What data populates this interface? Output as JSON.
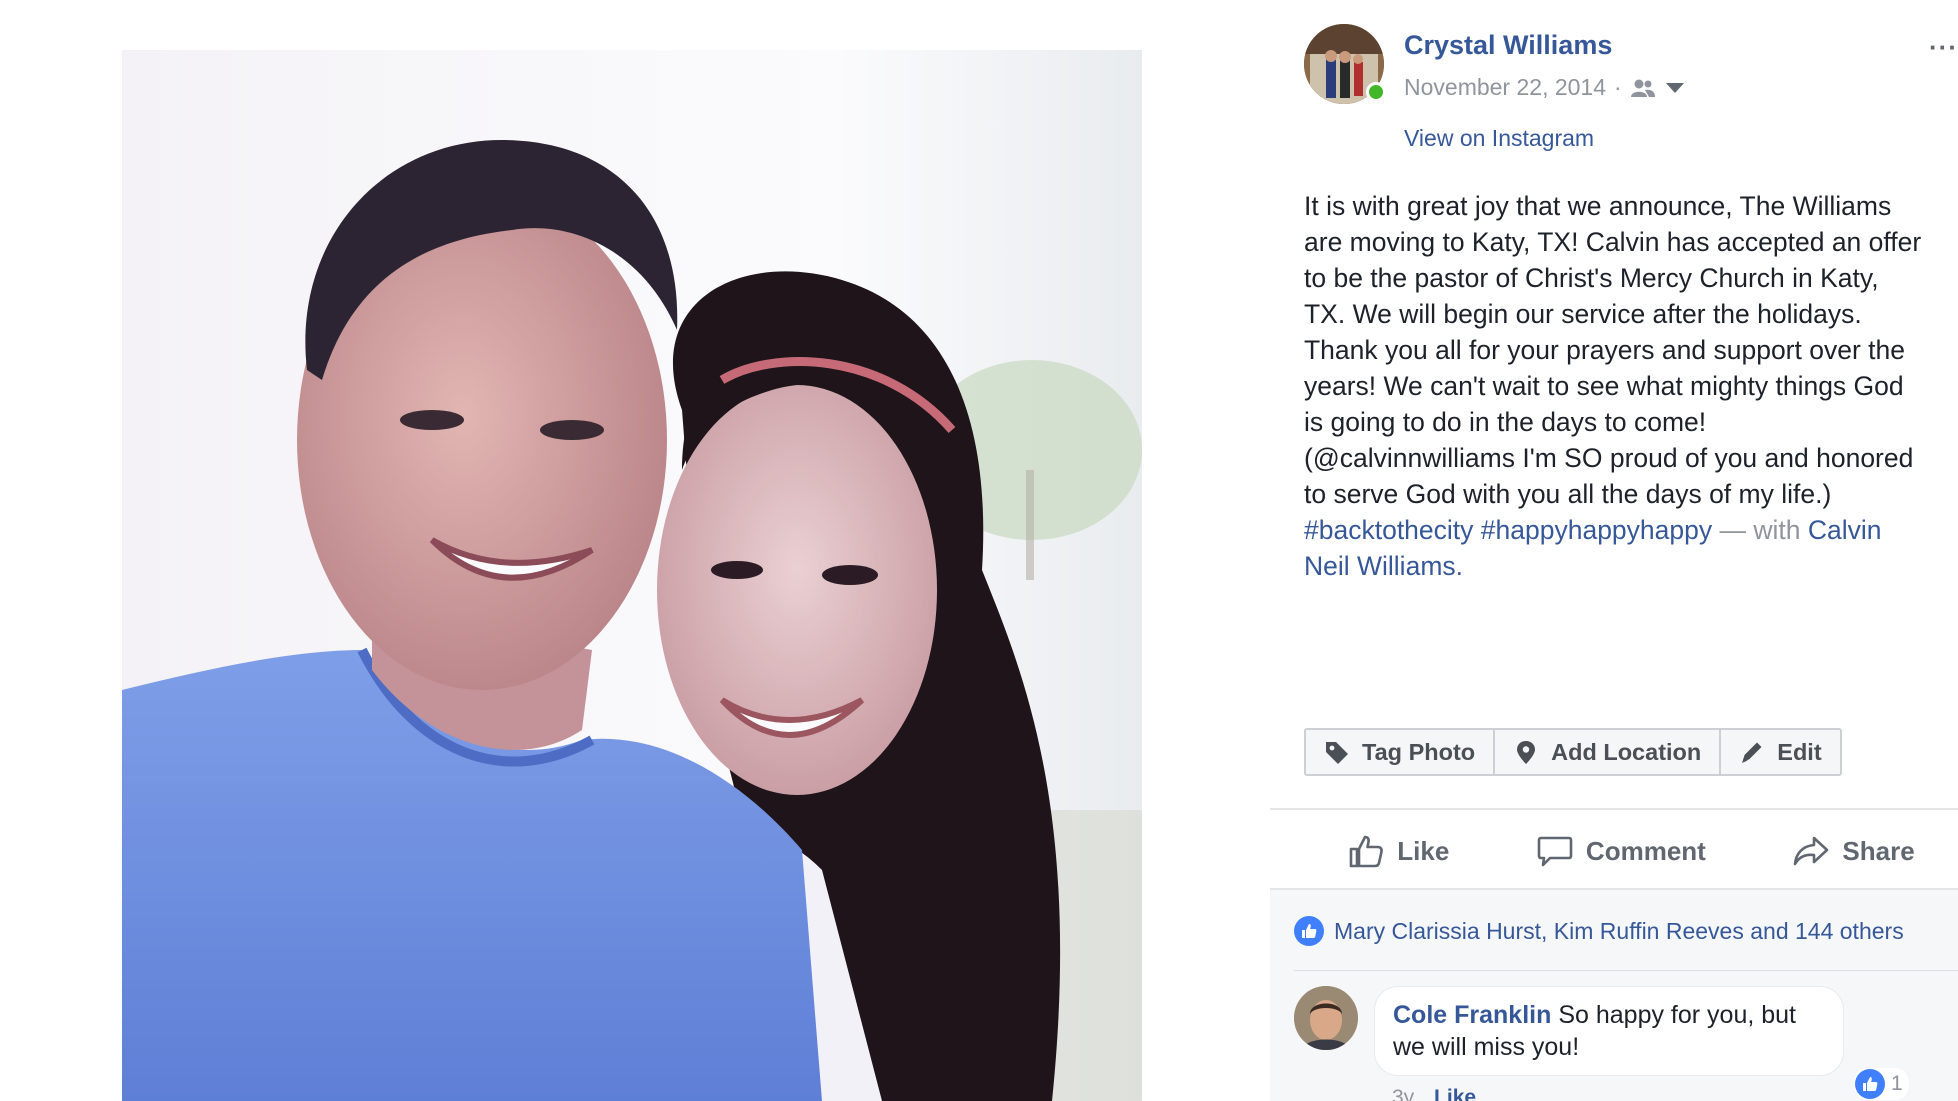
{
  "post": {
    "author": "Crystal Williams",
    "date": "November 22, 2014",
    "date_separator": "·",
    "instagram_link": "View on Instagram",
    "more": "···",
    "caption": "It is with great joy that we announce, The Williams\nare moving to Katy, TX! Calvin has accepted an offer\nto be the pastor of Christ's Mercy Church in Katy,\nTX. We will begin our service after the holidays.\nThank you all for your prayers and support over the\nyears! We can't wait to see what mighty things God\nis going to do in the days to come!\n(@calvinnwilliams I'm SO proud of you and honored\nto serve God with you all the days of my life.)",
    "hashtag_1": "#backtothecity",
    "hashtag_2": "#happyhappyhappy",
    "with_text": "— with",
    "tagged_name_1": "Calvin",
    "tagged_name_2": "Neil Williams."
  },
  "photo_actions": {
    "tag_photo": "Tag Photo",
    "add_location": "Add Location",
    "edit": "Edit"
  },
  "action_bar": {
    "like": "Like",
    "comment": "Comment",
    "share": "Share"
  },
  "reactions": {
    "summary": "Mary Clarissia Hurst, Kim Ruffin Reeves and 144 others"
  },
  "comments": [
    {
      "name": "Cole Franklin",
      "text": "So happy for you, but we will miss you!",
      "time": "3y",
      "like_label": "Like",
      "like_count": "1"
    }
  ],
  "icons": {
    "audience": "friends-icon",
    "caret": "caret-down-icon",
    "tag": "tag-icon",
    "location": "location-pin-icon",
    "edit": "pencil-icon",
    "like": "thumbs-up-icon",
    "comment": "comment-bubble-icon",
    "share": "share-arrow-icon"
  },
  "colors": {
    "link": "#365899",
    "online": "#42b72a",
    "like_badge": "#4080ff",
    "muted": "#90949c"
  }
}
